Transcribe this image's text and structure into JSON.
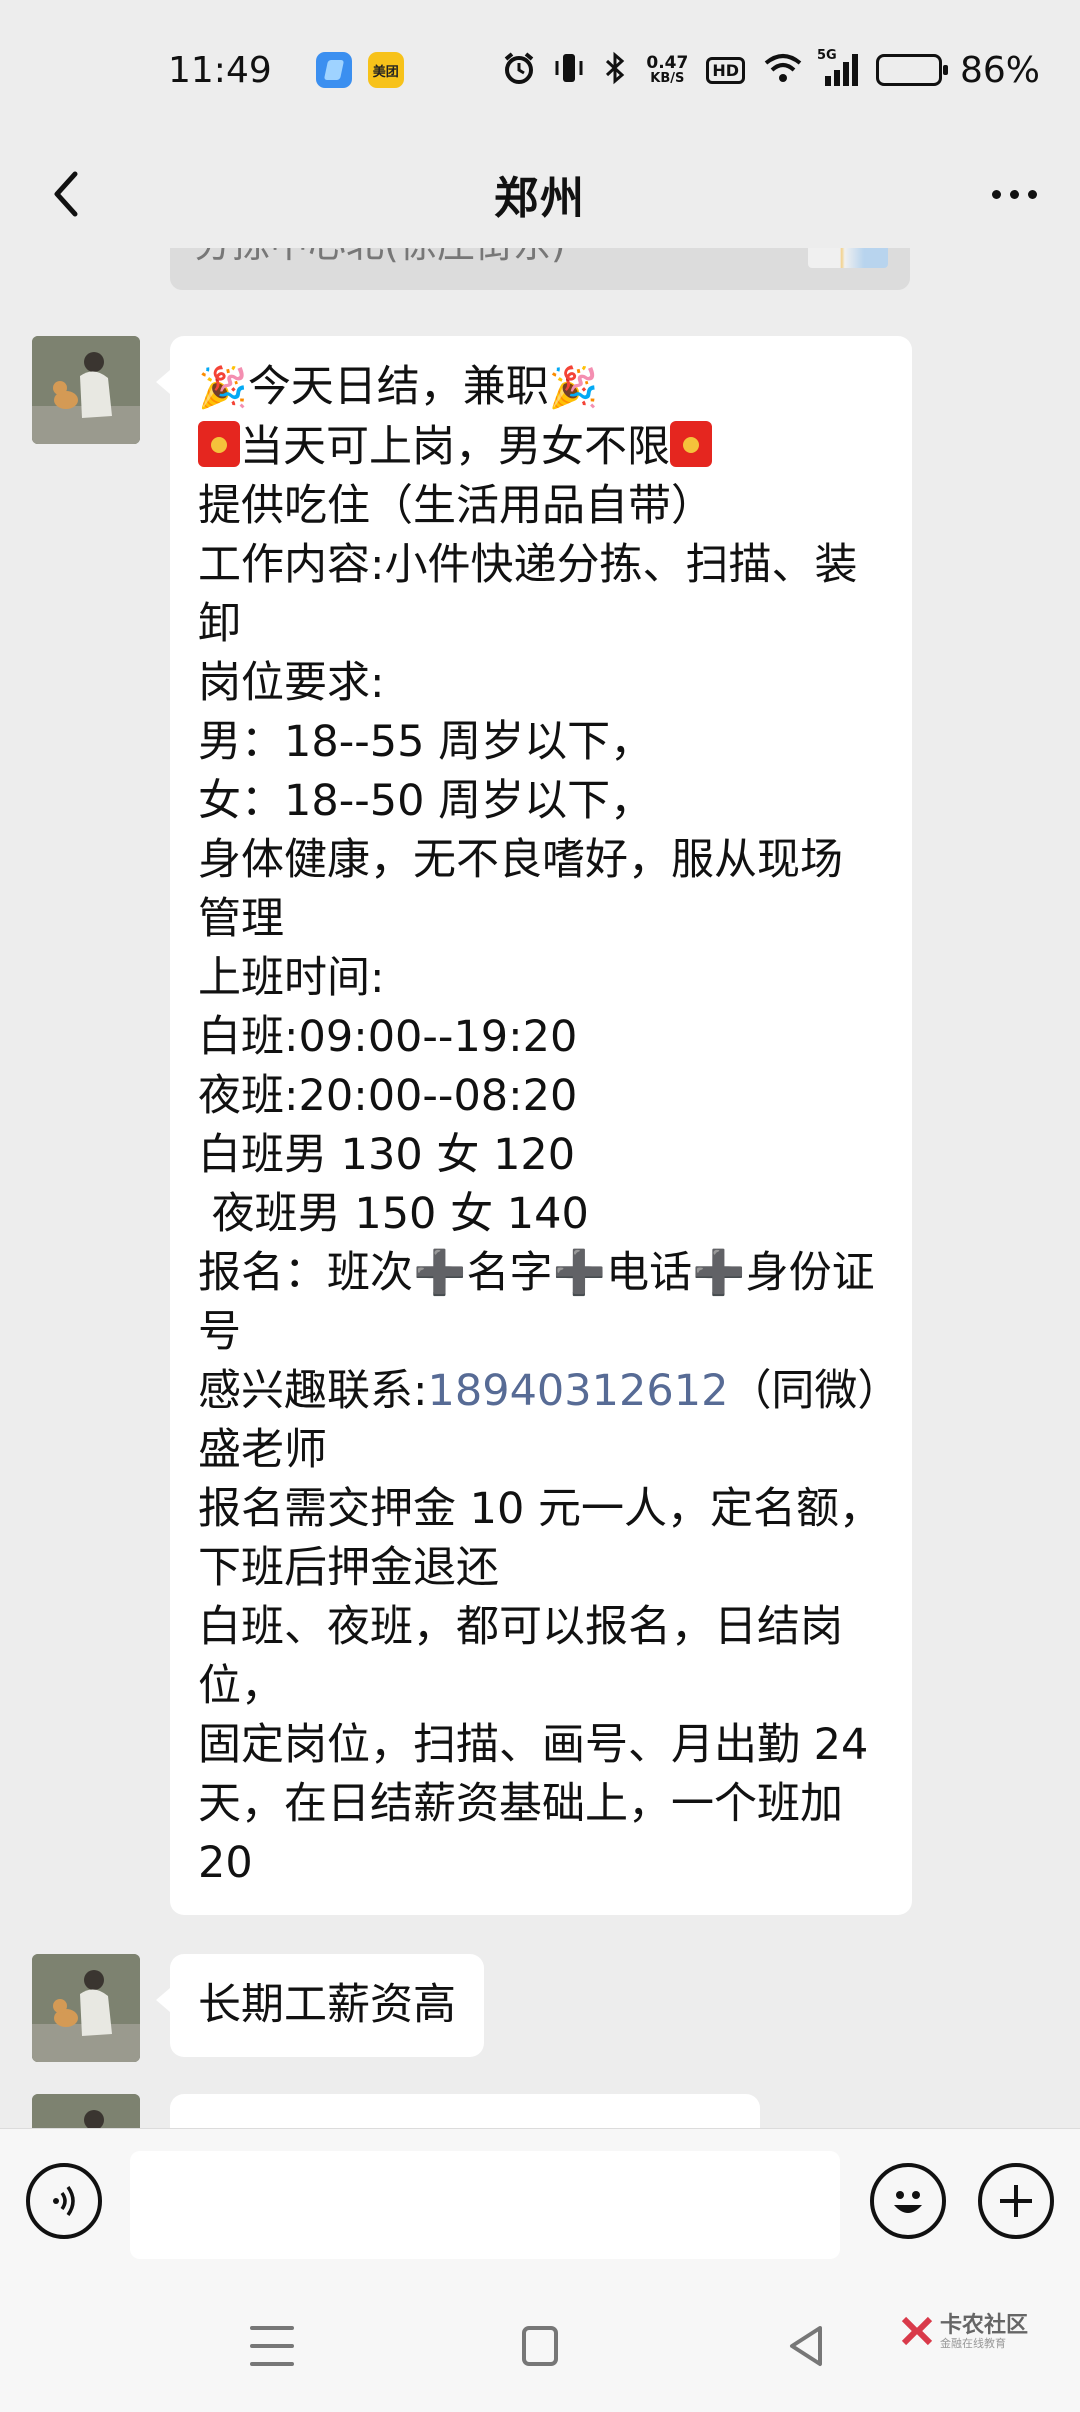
{
  "status_bar": {
    "time": "11:49",
    "app_badges": [
      "blue-app-icon",
      "美团"
    ],
    "net_speed_value": "0.47",
    "net_speed_unit": "KB/S",
    "hd_label": "HD",
    "signal_label": "5G",
    "battery_percent_text": "86%",
    "battery_level": 0.86
  },
  "header": {
    "title": "郑州",
    "back_icon": "chevron-left-icon",
    "more_icon": "more-dots-icon"
  },
  "previous_card": {
    "text": "分拣中心北(徐庄街东)"
  },
  "messages": [
    {
      "lines": [
        {
          "parts": [
            {
              "t": "party",
              "v": "🎉"
            },
            {
              "t": "text",
              "v": "今天日结，兼职"
            },
            {
              "t": "party",
              "v": "🎉"
            }
          ]
        },
        {
          "parts": [
            {
              "t": "red",
              "v": "🧧"
            },
            {
              "t": "text",
              "v": "当天可上岗，男女不限"
            },
            {
              "t": "red",
              "v": "🧧"
            }
          ]
        },
        {
          "parts": [
            {
              "t": "text",
              "v": "提供吃住（生活用品自带）"
            }
          ]
        },
        {
          "parts": [
            {
              "t": "text",
              "v": "工作内容:小件快递分拣、扫描、装卸"
            }
          ]
        },
        {
          "parts": [
            {
              "t": "text",
              "v": "岗位要求:"
            }
          ]
        },
        {
          "parts": [
            {
              "t": "text",
              "v": "男：18--55 周岁以下，"
            }
          ]
        },
        {
          "parts": [
            {
              "t": "text",
              "v": "女：18--50 周岁以下，"
            }
          ]
        },
        {
          "parts": [
            {
              "t": "text",
              "v": "身体健康，无不良嗜好，服从现场管理"
            }
          ]
        },
        {
          "parts": [
            {
              "t": "text",
              "v": "上班时间:"
            }
          ]
        },
        {
          "parts": [
            {
              "t": "text",
              "v": "白班:09:00--19:20"
            }
          ]
        },
        {
          "parts": [
            {
              "t": "text",
              "v": "夜班:20:00--08:20"
            }
          ]
        },
        {
          "parts": [
            {
              "t": "text",
              "v": "白班男 130 女 120"
            }
          ]
        },
        {
          "parts": [
            {
              "t": "text",
              "v": " 夜班男 150 女 140"
            }
          ]
        },
        {
          "parts": [
            {
              "t": "text",
              "v": "报名：班次➕名字➕电话➕身份证号"
            }
          ]
        },
        {
          "parts": [
            {
              "t": "text",
              "v": "感兴趣联系:"
            },
            {
              "t": "link",
              "v": "18940312612"
            },
            {
              "t": "text",
              "v": "（同微）盛老师"
            }
          ]
        },
        {
          "parts": [
            {
              "t": "text",
              "v": "报名需交押金 10 元一人，定名额，下班后押金退还"
            }
          ]
        },
        {
          "parts": [
            {
              "t": "text",
              "v": "白班、夜班，都可以报名，日结岗位，"
            }
          ]
        },
        {
          "parts": [
            {
              "t": "text",
              "v": "固定岗位，扫描、画号、月出勤 24天，在日结薪资基础上，一个班加20"
            }
          ]
        }
      ]
    },
    {
      "lines": [
        {
          "parts": [
            {
              "t": "text",
              "v": "长期工薪资高"
            }
          ]
        }
      ]
    }
  ],
  "input_bar": {
    "voice_icon": "voice-icon",
    "input_value": "",
    "emoji_icon": "emoji-icon",
    "plus_icon": "plus-icon"
  },
  "nav_bar": {
    "menu_icon": "menu-icon",
    "home_icon": "home-icon",
    "back_icon": "back-triangle-icon"
  },
  "watermark": {
    "title": "卡农社区",
    "subtitle": "金融在线教育"
  },
  "colors": {
    "link": "#576b95",
    "chat_background": "#ededed",
    "bubble": "#ffffff"
  }
}
